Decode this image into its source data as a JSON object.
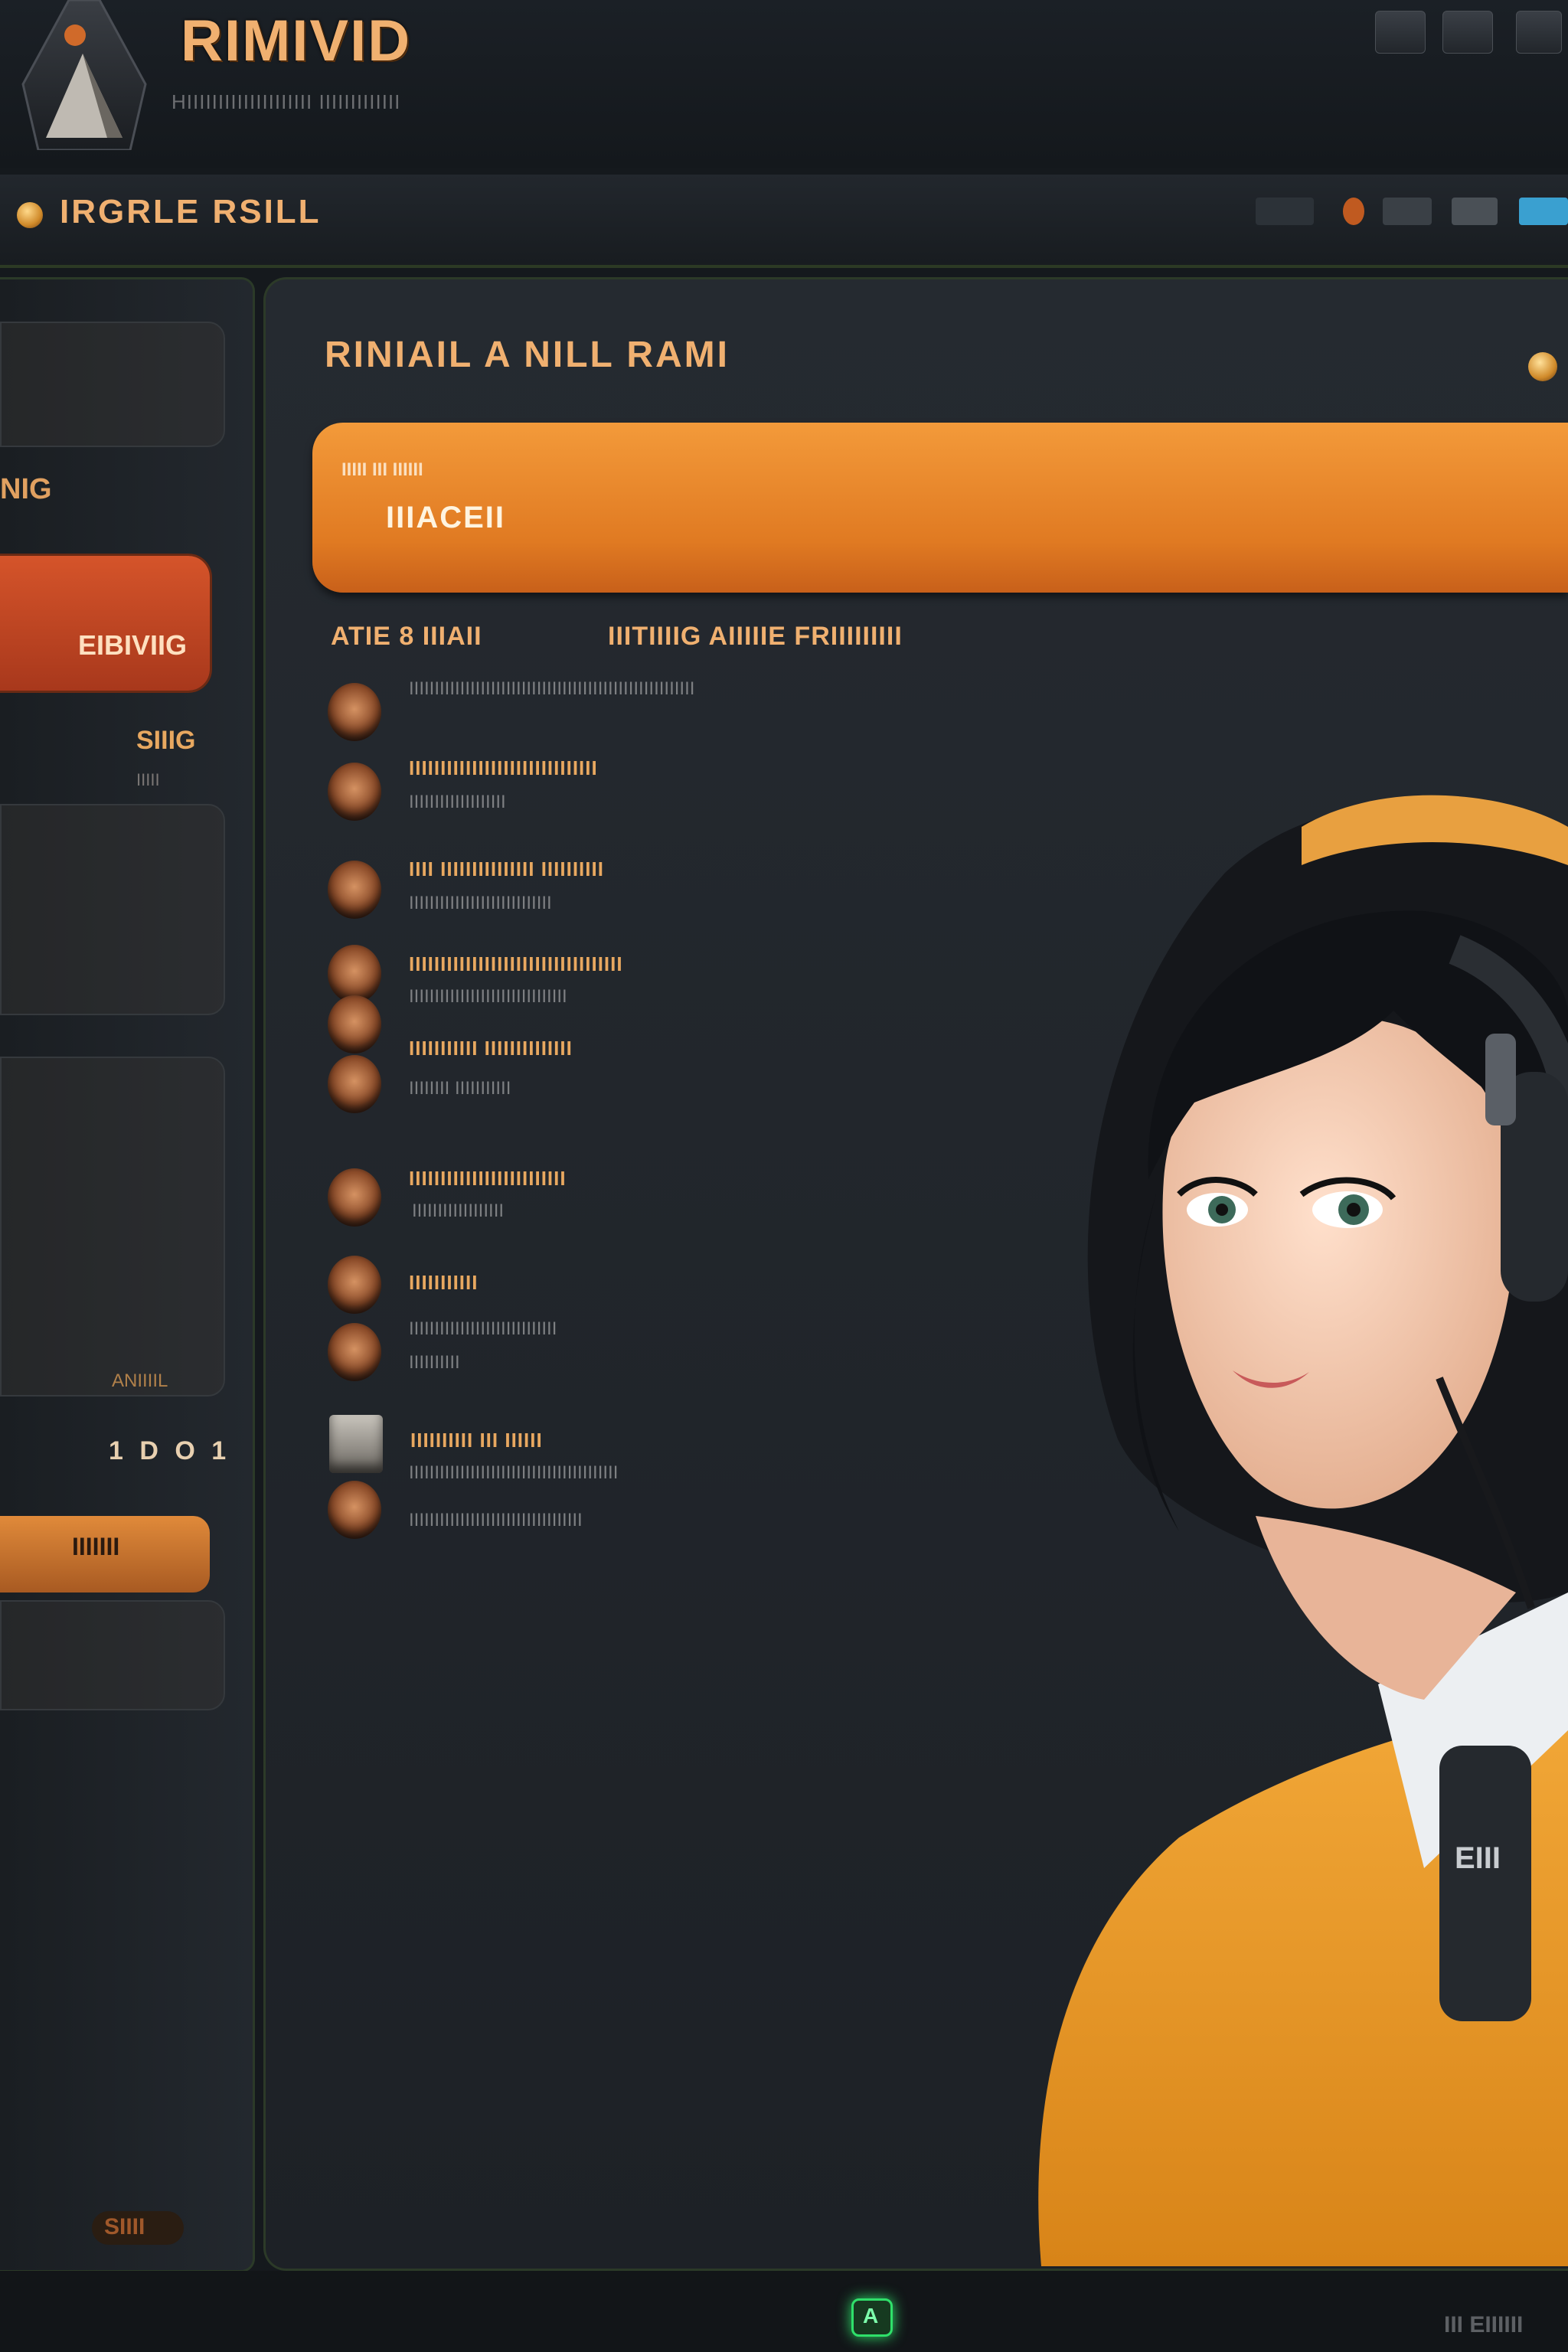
{
  "header": {
    "app_title": "RIMIVID",
    "app_subtitle": "HIIIIIIIIIIIIIIIIIIII IIIIIIIIIIIII"
  },
  "navbar": {
    "title": "IRGRLE RSILL"
  },
  "left_panel": {
    "label_1": "NIG",
    "primary_button": "EIBIVIIG",
    "label_2": "SIIIG",
    "sublabel_2": "IIIII",
    "card_label": "ANIIIIL",
    "counter": "1 D O 1",
    "secondary_button": "IIIIIII",
    "badge": "SIIII"
  },
  "main": {
    "title": "RINIAIL A NILL RAMI",
    "banner": {
      "kicker": "IIIII III  IIIIII",
      "title": "IIIACEII"
    },
    "columns": [
      "ATIE 8 IIIAII",
      "IIITIIIIG AIIIIIE FRIIIIIIIII"
    ],
    "rows": [
      {
        "title": "",
        "sub": "IIIIIIIIIIIIIIIIIIIIIIIIIIIIIIIIIIIIIIIIIIIIIIIIIIIIIIII"
      },
      {
        "title": "IIIIIIIIIIIIIIIIIIIIIIIIIIIIII",
        "sub": "IIIIIIIIIIIIIIIIIII"
      },
      {
        "title": "IIII IIIIIIIIIIIIIII IIIIIIIIII",
        "sub": "IIIIIIIIIIIIIIIIIIIIIIIIIIII"
      },
      {
        "title": "IIIIIIIIIIIIIIIIIIIIIIIIIIIIIIIIII",
        "sub": "IIIIIIIIIIIIIIIIIIIIIIIIIIIIIII"
      },
      {
        "title": "IIIIIIIIIII IIIIIIIIIIIIII",
        "sub": "IIIIIIII IIIIIIIIIII"
      },
      {
        "title": "IIIIIIIIIIIIIIIIIIIIIIIII",
        "sub": "IIIIIIIIIIIIIIIIII"
      },
      {
        "title": "IIIIIIIIIII",
        "sub": "IIIIIIIIIIIIIIIIIIIIIIIIIIIII"
      },
      {
        "title": "IIIIIIIIII III IIIIII",
        "sub": "IIIIIIIIIIIIIIIIIIIIIIIIIIIIIIIIIIIIIIIII"
      }
    ],
    "extra_sub_1": "IIIIIIIIII",
    "extra_sub_2": "IIIIIIIIIIIIIIIIIIIIIIIIIIIIIIIIII"
  },
  "character": {
    "badge_text": "EIII"
  },
  "bottombar": {
    "indicator": "A",
    "right_text": "III EIIIIII"
  },
  "icons": {
    "logo": "emblem-icon",
    "header_buttons": [
      "window-icon",
      "window-icon",
      "window-icon"
    ],
    "status_dot": "status-dot-icon"
  },
  "colors": {
    "accent_orange": "#e88a30",
    "accent_red": "#c44524",
    "text_gold": "#f0b070",
    "panel_bg": "#22272d",
    "indicator_green": "#2fe06a"
  }
}
